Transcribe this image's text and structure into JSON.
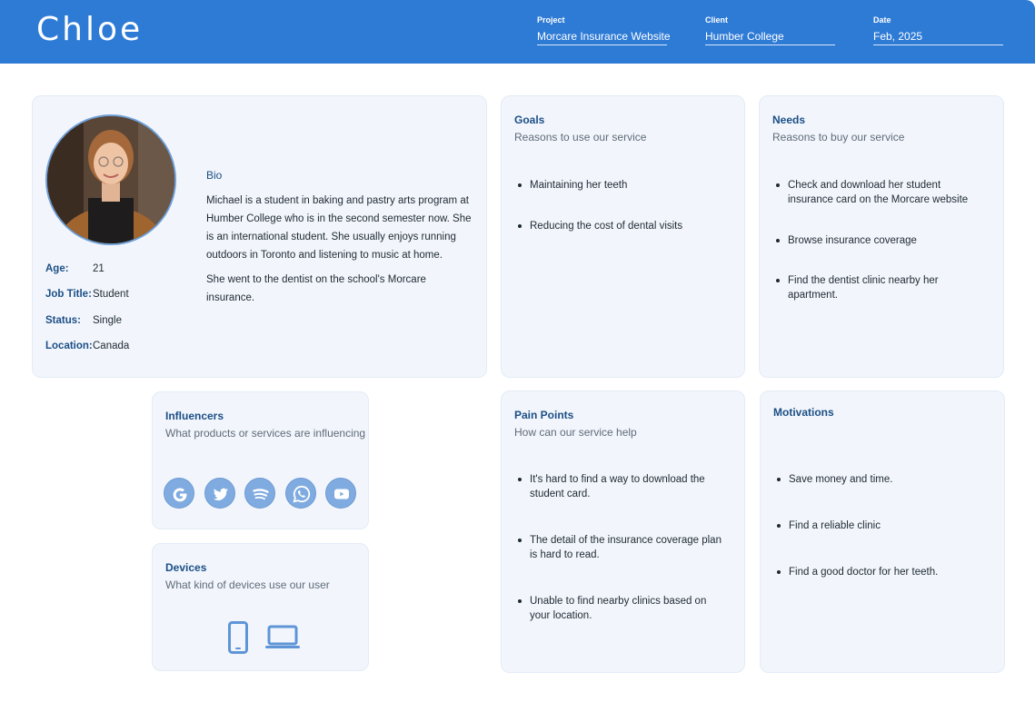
{
  "header": {
    "name": "Chloe",
    "project_label": "Project",
    "project_value": "Morcare Insurance Website",
    "client_label": "Client",
    "client_value": "Humber College",
    "date_label": "Date",
    "date_value": "Feb, 2025",
    "bg_color": "#2e7bd6"
  },
  "profile": {
    "stats": [
      {
        "label": "Age:",
        "value": "21"
      },
      {
        "label": "Job Title:",
        "value": "Student"
      },
      {
        "label": "Status:",
        "value": "Single"
      },
      {
        "label": "Location:",
        "value": "Canada"
      }
    ],
    "bio_title": "Bio",
    "bio_paragraphs": [
      "Michael is a student in baking and pastry arts program at Humber College who is in the second semester now. She is an international student. She usually enjoys running outdoors in Toronto and listening to music at home.",
      "She went to the dentist on the school's Morcare insurance."
    ]
  },
  "goals": {
    "title": "Goals",
    "subtitle": "Reasons to use our service",
    "items": [
      "Maintaining her teeth",
      "Reducing the cost of dental visits"
    ]
  },
  "needs": {
    "title": "Needs",
    "subtitle": "Reasons to buy our service",
    "items": [
      "Check and download her student insurance card on the Morcare website",
      "Browse insurance coverage",
      "Find the dentist clinic nearby her apartment."
    ]
  },
  "influencers": {
    "title": "Influencers",
    "subtitle": "What products or services are influencing",
    "icons": [
      "google-icon",
      "twitter-icon",
      "spotify-icon",
      "whatsapp-icon",
      "youtube-icon"
    ]
  },
  "devices": {
    "title": "Devices",
    "subtitle": "What kind of devices use our user",
    "icons": [
      "smartphone-icon",
      "laptop-icon"
    ]
  },
  "pain_points": {
    "title": "Pain Points",
    "subtitle": "How can our service help",
    "items": [
      "It's hard to find a way to download the student card.",
      "The detail of the insurance coverage plan is hard to read.",
      "Unable to find nearby clinics based on your location."
    ]
  },
  "motivations": {
    "title": "Motivations",
    "items": [
      "Save money and time.",
      "Find a reliable clinic",
      "Find a good doctor for her teeth."
    ]
  },
  "colors": {
    "accent": "#2e7bd6",
    "heading": "#1c4f86",
    "card_bg": "#f2f6fc",
    "icon_fill": "#7fabe0"
  }
}
